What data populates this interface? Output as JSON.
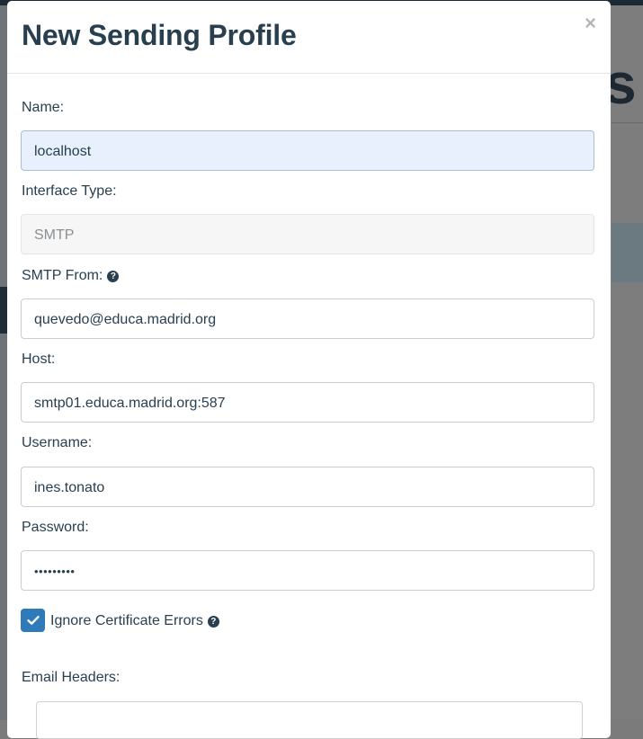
{
  "modal": {
    "title": "New Sending Profile",
    "close_label": "×"
  },
  "fields": {
    "name": {
      "label": "Name:",
      "value": "localhost"
    },
    "interface_type": {
      "label": "Interface Type:",
      "value": "SMTP"
    },
    "smtp_from": {
      "label": "SMTP From:",
      "value": "quevedo@educa.madrid.org"
    },
    "host": {
      "label": "Host:",
      "value": "smtp01.educa.madrid.org:587"
    },
    "username": {
      "label": "Username:",
      "value": "ines.tonato"
    },
    "password": {
      "label": "Password:",
      "value": "•••••••••"
    }
  },
  "ignore_cert": {
    "label": "Ignore Certificate Errors",
    "checked": true
  },
  "email_headers": {
    "label": "Email Headers:"
  },
  "colors": {
    "accent": "#2f7ab8",
    "text": "#283f50",
    "focused_field": "#e8f0fe"
  }
}
